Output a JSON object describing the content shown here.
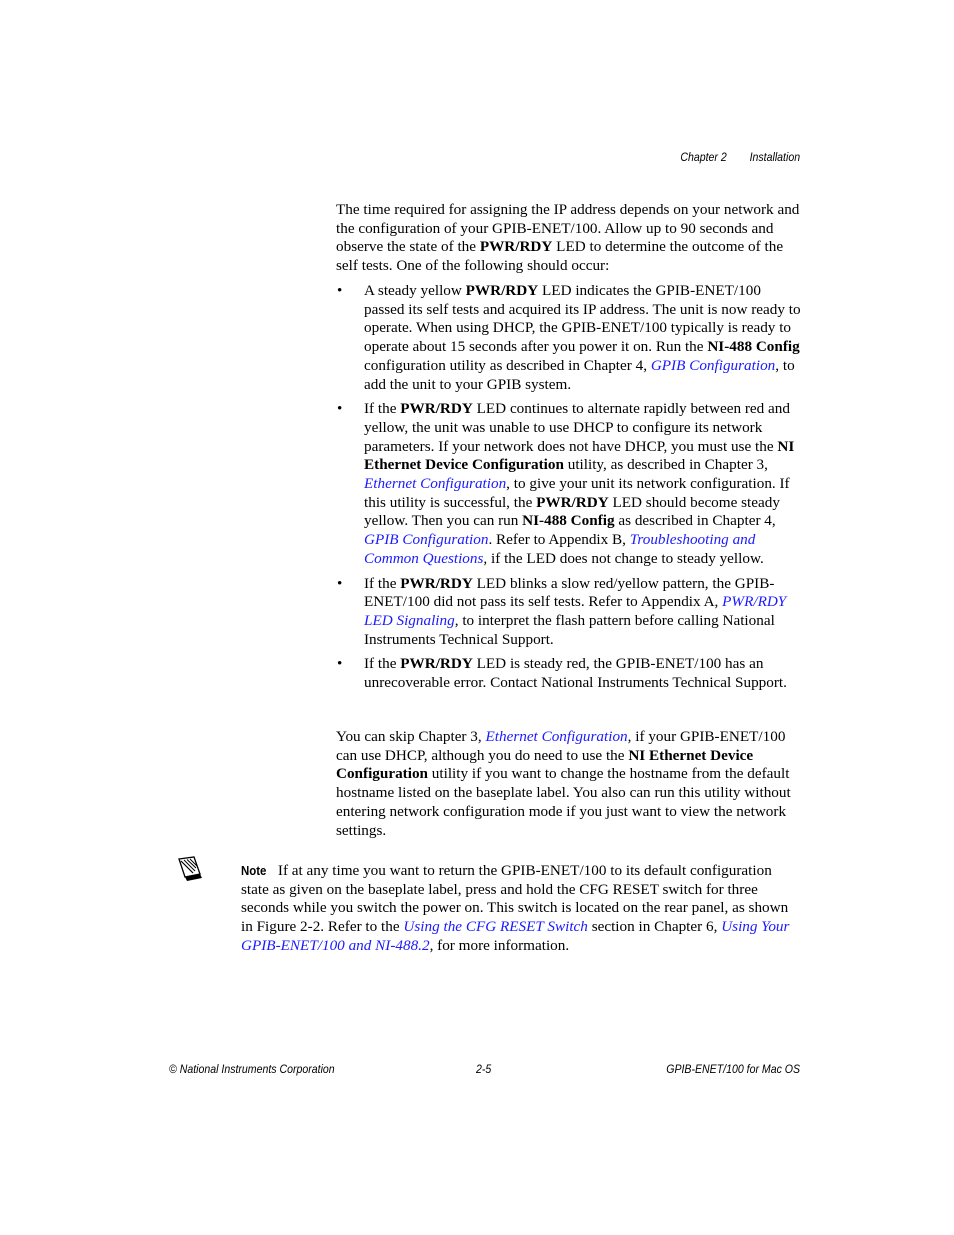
{
  "header": {
    "chapter": "Chapter 2",
    "section": "Installation"
  },
  "intro_paragraph": {
    "t1": "The time required for assigning the IP address depends on your network and the configuration of your GPIB-ENET/100. Allow up to 90 seconds and observe the state of the ",
    "b1": "PWR/RDY",
    "t2": " LED to determine the outcome of the self tests. One of the following should occur:"
  },
  "bullets": [
    {
      "t1": "A steady yellow ",
      "b1": "PWR/RDY",
      "t2": " LED indicates the GPIB-ENET/100 passed its self tests and acquired its IP address. The unit is now ready to operate. When using DHCP, the GPIB-ENET/100 typically is ready to operate about 15 seconds after you power it on. Run the ",
      "b2": "NI-488 Config",
      "t3": " configuration utility as described in Chapter 4, ",
      "l1": "GPIB Configuration",
      "t4": ", to add the unit to your GPIB system."
    },
    {
      "t1": "If the ",
      "b1": "PWR/RDY",
      "t2": " LED continues to alternate rapidly between red and yellow, the unit was unable to use DHCP to configure its network parameters. If your network does not have DHCP, you must use the ",
      "b2": "NI Ethernet Device Configuration",
      "t3": " utility, as described in Chapter 3, ",
      "l1": "Ethernet Configuration",
      "t4": ", to give your unit its network configuration. If this utility is successful, the ",
      "b3": "PWR/RDY",
      "t5": " LED should become steady yellow. Then you can run ",
      "b4": "NI-488 Config",
      "t6": " as described in Chapter 4, ",
      "l2": "GPIB Configuration",
      "t7": ". Refer to Appendix B, ",
      "l3": "Troubleshooting and Common Questions",
      "t8": ", if the LED does not change to steady yellow."
    },
    {
      "t1": "If the ",
      "b1": "PWR/RDY",
      "t2": " LED blinks a slow red/yellow pattern, the GPIB-ENET/100 did not pass its self tests. Refer to Appendix A, ",
      "l1": "PWR/RDY LED Signaling",
      "t3": ", to interpret the flash pattern before calling National Instruments Technical Support."
    },
    {
      "t1": "If the ",
      "b1": "PWR/RDY",
      "t2": " LED is steady red, the GPIB-ENET/100 has an unrecoverable error. Contact National Instruments Technical Support."
    }
  ],
  "bullet_glyph": "•",
  "skip_paragraph": {
    "t1": "You can skip Chapter 3, ",
    "l1": "Ethernet Configuration",
    "t2": ", if your GPIB-ENET/100 can use DHCP, although you do need to use the ",
    "b1": "NI Ethernet Device Configuration",
    "t3": " utility if you want to change the hostname from the default hostname listed on the baseplate label. You also can run this utility without entering network configuration mode if you just want to view the network settings."
  },
  "note": {
    "icon": "note-pencil-icon",
    "label": "Note",
    "t1": "If at any time you want to return the GPIB-ENET/100 to its default configuration state as given on the baseplate label, press and hold the CFG RESET switch for three seconds while you switch the power on. This switch is located on the rear panel, as shown in Figure 2-2. Refer to the ",
    "l1": "Using the CFG RESET Switch",
    "t2": " section in Chapter 6, ",
    "l2": "Using Your GPIB-ENET/100 and NI-488.2",
    "t3": ", for more information."
  },
  "footer": {
    "left": "© National Instruments Corporation",
    "center": "2-5",
    "right": "GPIB-ENET/100 for Mac OS"
  },
  "colors": {
    "link": "#1a1aff",
    "text": "#000000",
    "background": "#ffffff"
  }
}
